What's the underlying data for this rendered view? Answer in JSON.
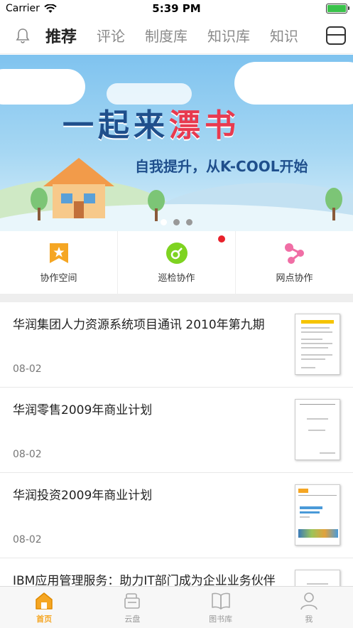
{
  "status_bar": {
    "carrier": "Carrier",
    "time": "5:39 PM"
  },
  "top_tabs": {
    "items": [
      "推荐",
      "评论",
      "制度库",
      "知识库",
      "知识"
    ],
    "active_index": 0
  },
  "banner": {
    "title_part1": "一起来",
    "title_part2": "漂书",
    "subtitle": "自我提升，从K-COOL开始",
    "page_count": 3,
    "active_page": 0
  },
  "quick_actions": [
    {
      "label": "协作空间",
      "icon": "bookmark-star-icon",
      "color": "#f5a623"
    },
    {
      "label": "巡检协作",
      "icon": "check-circle-icon",
      "color": "#7ed321",
      "badge": true
    },
    {
      "label": "网点协作",
      "icon": "share-nodes-icon",
      "color": "#f06ea5"
    }
  ],
  "articles": [
    {
      "title": "华润集团人力资源系统项目通讯 2010年第九期",
      "date": "08-02"
    },
    {
      "title": "华润零售2009年商业计划",
      "date": "08-02"
    },
    {
      "title": "华润投资2009年商业计划",
      "date": "08-02"
    },
    {
      "title": "IBM应用管理服务：助力IT部门成为企业业务伙伴",
      "date": ""
    }
  ],
  "bottom_nav": [
    {
      "label": "首页",
      "icon": "home-icon",
      "active": true
    },
    {
      "label": "云盘",
      "icon": "cloud-drive-icon",
      "active": false
    },
    {
      "label": "图书库",
      "icon": "book-icon",
      "active": false
    },
    {
      "label": "我",
      "icon": "user-icon",
      "active": false
    }
  ],
  "colors": {
    "accent": "#f5a623",
    "badge": "#e8212b"
  }
}
